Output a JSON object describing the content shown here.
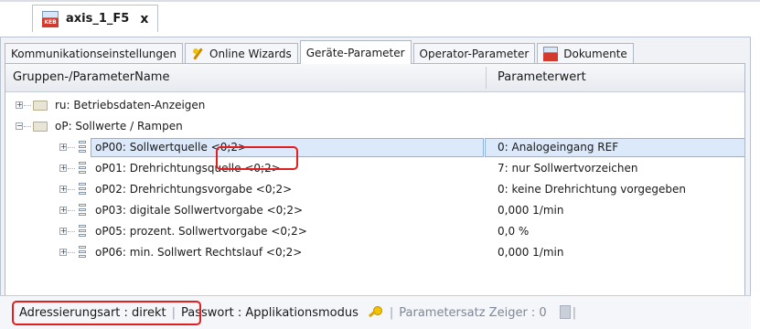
{
  "document_tab": {
    "title": "axis_1_F5",
    "close_glyph": "x",
    "icon": "keb-document-icon"
  },
  "tabs": [
    {
      "label": "Kommunikationseinstellungen",
      "icon": ""
    },
    {
      "label": "Online Wizards",
      "icon": "wand-icon"
    },
    {
      "label": "Geräte-Parameter",
      "icon": "",
      "active": true
    },
    {
      "label": "Operator-Parameter",
      "icon": ""
    },
    {
      "label": "Dokumente",
      "icon": "keb-document-icon"
    }
  ],
  "columns": {
    "name": "Gruppen-/ParameterName",
    "value": "Parameterwert"
  },
  "tree": {
    "group_ru": {
      "label": "ru: Betriebsdaten-Anzeigen",
      "expander": "+"
    },
    "group_op": {
      "label": "oP: Sollwerte / Rampen",
      "expander": "−"
    },
    "params": [
      {
        "name": "oP00: Sollwertquelle <0;2>",
        "value": "0: Analogeingang REF",
        "selected": true
      },
      {
        "name": "oP01: Drehrichtungsquelle <0;2>",
        "value": "7: nur Sollwertvorzeichen"
      },
      {
        "name": "oP02: Drehrichtungsvorgabe <0;2>",
        "value": "0: keine Drehrichtung vorgegeben"
      },
      {
        "name": "oP03: digitale Sollwertvorgabe <0;2>",
        "value": "0,000 1/min"
      },
      {
        "name": "oP05: prozent. Sollwertvorgabe <0;2>",
        "value": "0,0 %"
      },
      {
        "name": "oP06: min. Sollwert Rechtslauf <0;2>",
        "value": "0,000 1/min"
      }
    ],
    "param_expander": "+"
  },
  "statusbar": {
    "addressing": "Adressierungsart : direkt",
    "password": "Passwort : Applikationsmodus",
    "sep": "|",
    "paramset": "Parametersatz Zeiger : 0"
  },
  "colors": {
    "highlight": "#e02020",
    "selection": "#dbe9fb"
  }
}
